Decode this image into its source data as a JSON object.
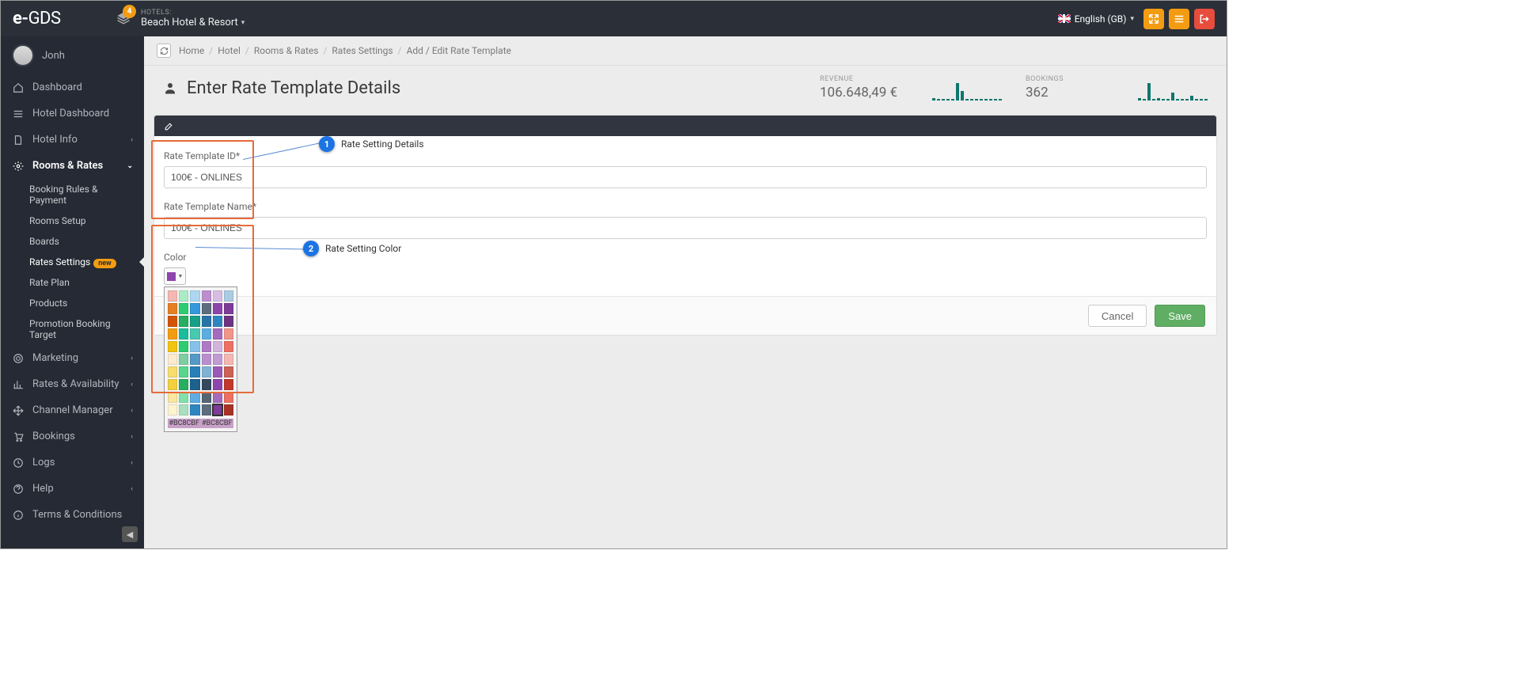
{
  "brand": "e-GDS",
  "notif_count": "4",
  "hotel_label": "HOTELS:",
  "hotel_name": "Beach Hotel & Resort",
  "language": "English (GB)",
  "user_name": "Jonh",
  "sidebar": [
    {
      "icon": "home",
      "label": "Dashboard",
      "arrow": false
    },
    {
      "icon": "list",
      "label": "Hotel Dashboard",
      "arrow": false
    },
    {
      "icon": "doc",
      "label": "Hotel Info",
      "arrow": true
    },
    {
      "icon": "gear",
      "label": "Rooms & Rates",
      "arrow": true,
      "active": true,
      "open": true,
      "children": [
        {
          "label": "Booking Rules & Payment"
        },
        {
          "label": "Rooms Setup"
        },
        {
          "label": "Boards"
        },
        {
          "label": "Rates Settings",
          "new": true,
          "current": true
        },
        {
          "label": "Rate Plan"
        },
        {
          "label": "Products"
        },
        {
          "label": "Promotion Booking Target"
        }
      ]
    },
    {
      "icon": "target",
      "label": "Marketing",
      "arrow": true
    },
    {
      "icon": "chart",
      "label": "Rates & Availability",
      "arrow": true
    },
    {
      "icon": "move",
      "label": "Channel Manager",
      "arrow": true
    },
    {
      "icon": "cart",
      "label": "Bookings",
      "arrow": true
    },
    {
      "icon": "clock",
      "label": "Logs",
      "arrow": true
    },
    {
      "icon": "help",
      "label": "Help",
      "arrow": true
    },
    {
      "icon": "info",
      "label": "Terms & Conditions",
      "arrow": false
    }
  ],
  "breadcrumbs": [
    "Home",
    "Hotel",
    "Rooms & Rates",
    "Rates Settings",
    "Add / Edit Rate Template"
  ],
  "page_title": "Enter Rate Template Details",
  "stats": {
    "revenue_label": "REVENUE",
    "revenue_value": "106.648,49 €",
    "bookings_label": "BOOKINGS",
    "bookings_value": "362"
  },
  "form": {
    "id_label": "Rate Template ID*",
    "id_value": "100€ - ONLINES",
    "name_label": "Rate Template Name*",
    "name_value": "100€ - ONLINES",
    "color_label": "Color",
    "selected_color": "#8e44ad",
    "hex_text": "#BC8CBF"
  },
  "colors": [
    [
      "#f5b7b1",
      "#abebc6",
      "#aed6f1",
      "#bb8fce",
      "#d7bde2",
      "#a9cce3"
    ],
    [
      "#e67e22",
      "#2ecc71",
      "#3498db",
      "#5d6d7e",
      "#8e44ad",
      "#7d3c98"
    ],
    [
      "#d35400",
      "#27ae60",
      "#16a085",
      "#2874a6",
      "#2e86c1",
      "#6c3483"
    ],
    [
      "#f39c12",
      "#1abc9c",
      "#48c9b0",
      "#5dade2",
      "#a569bd",
      "#f1948a"
    ],
    [
      "#f1c40f",
      "#2ecc71",
      "#85c1e9",
      "#af7ac5",
      "#d2b4de",
      "#ec7063"
    ],
    [
      "#fdebd0",
      "#7dcea0",
      "#5499c7",
      "#bb8fce",
      "#c39bd3",
      "#f5b7b1"
    ],
    [
      "#f7dc6f",
      "#58d68d",
      "#2980b9",
      "#7fb3d5",
      "#9b59b6",
      "#cd6155"
    ],
    [
      "#f4d03f",
      "#27ae60",
      "#1f618d",
      "#34495e",
      "#8e44ad",
      "#c0392b"
    ],
    [
      "#f9e79f",
      "#82e0aa",
      "#5dade2",
      "#566573",
      "#a569bd",
      "#ec7063"
    ],
    [
      "#fcf3cf",
      "#a9dfbf",
      "#2e86c1",
      "#5d6d7e",
      "#7d3c98",
      "#a93226"
    ]
  ],
  "selected_swatch": [
    9,
    4
  ],
  "callouts": {
    "c1": "Rate Setting Details",
    "c2": "Rate Setting Color"
  },
  "buttons": {
    "cancel": "Cancel",
    "save": "Save"
  },
  "sparks": {
    "rev": [
      3,
      2,
      2,
      2,
      2,
      22,
      12,
      2,
      2,
      2,
      2,
      2,
      2,
      2,
      2
    ],
    "book": [
      3,
      2,
      22,
      2,
      3,
      2,
      2,
      10,
      2,
      2,
      2,
      6,
      2,
      2,
      2
    ]
  },
  "badge_new": "new"
}
